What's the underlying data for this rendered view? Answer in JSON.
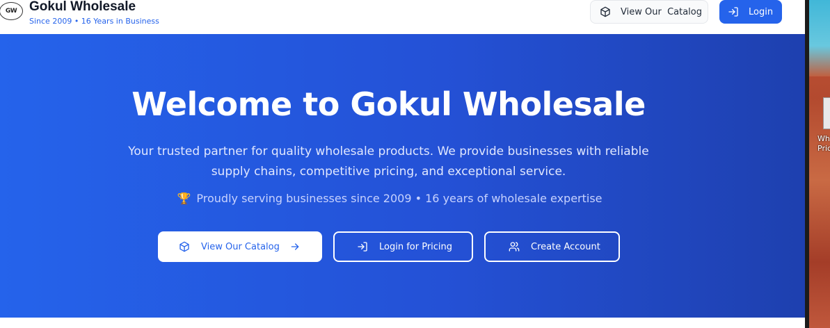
{
  "header": {
    "logo_text": "GW",
    "brand_name": "Gokul Wholesale",
    "brand_sub": "Since 2009 • 16 Years in Business",
    "catalog_button": "View Our  Catalog",
    "login_button": "Login"
  },
  "hero": {
    "title": "Welcome to Gokul Wholesale",
    "description": "Your trusted partner for quality wholesale products. We provide businesses with reliable supply chains, competitive pricing, and exceptional service.",
    "since_icon": "🏆",
    "since_text": "Proudly serving businesses since 2009 • 16 years of wholesale expertise",
    "buttons": {
      "catalog": "View Our Catalog",
      "pricing": "Login for Pricing",
      "account": "Create Account"
    }
  },
  "desktop": {
    "icon_label_line1": "Wh",
    "icon_label_line2": "Pric"
  },
  "colors": {
    "primary": "#2563eb",
    "hero_gradient_end": "#1e40af"
  },
  "icons": [
    "logo-emblem-icon",
    "box-icon",
    "log-in-icon",
    "arrow-right-icon",
    "users-icon",
    "trophy-icon"
  ]
}
